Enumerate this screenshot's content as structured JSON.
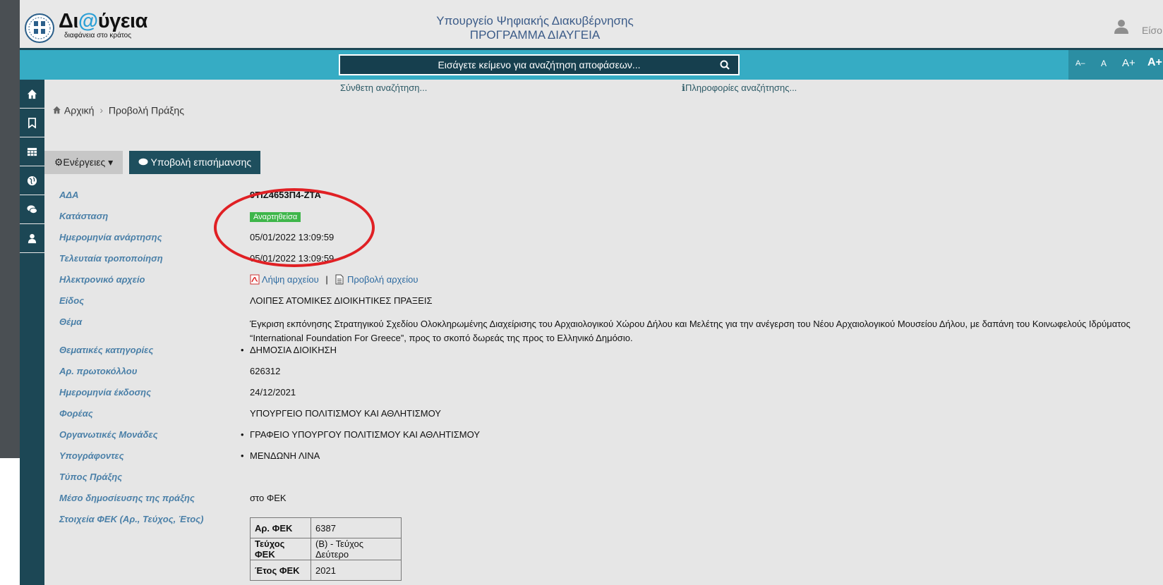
{
  "header": {
    "brand_title_pre": "Δι",
    "brand_title_at": "@",
    "brand_title_post": "ύγεια",
    "brand_subtitle": "διαφάνεια στο κράτος",
    "ministry_line1": "Υπουργείο Ψηφιακής Διακυβέρνησης",
    "ministry_line2": "ΠΡΟΓΡΑΜΜΑ ΔΙΑΥΓΕΙΑ",
    "login_label": "Είσο"
  },
  "search": {
    "placeholder": "Εισάγετε κείμενο για αναζήτηση αποφάσεων...",
    "advanced_link": "Σύνθετη αναζήτηση...",
    "info_link": "Πληροφορίες αναζήτησης...",
    "font_sizes": [
      "A–",
      "A",
      "A+",
      "A+"
    ]
  },
  "sidebar": {
    "icons": [
      "home-icon",
      "bookmark-icon",
      "table-icon",
      "globe-icon",
      "comments-icon",
      "user-icon"
    ]
  },
  "breadcrumb": {
    "home": "Αρχική",
    "current": "Προβολή Πράξης"
  },
  "actions": {
    "actions_label": "Ενέργειες",
    "submit_label": "Υποβολή επισήμανσης"
  },
  "fields": {
    "ada_label": "ΑΔΑ",
    "ada_value": "9ΤΙΖ4653Π4-ΖΤΑ",
    "status_label": "Κατάσταση",
    "status_value": "Αναρτηθείσα",
    "published_label": "Ημερομηνία ανάρτησης",
    "published_value": "05/01/2022 13:09:59",
    "modified_label": "Τελευταία τροποποίηση",
    "modified_value": "05/01/2022 13:09:59",
    "file_label": "Ηλεκτρονικό αρχείο",
    "file_download": "Λήψη αρχείου",
    "file_separator": "|",
    "file_view": "Προβολή αρχείου",
    "type_label": "Είδος",
    "type_value": "ΛΟΙΠΕΣ ΑΤΟΜΙΚΕΣ ΔΙΟΙΚΗΤΙΚΕΣ ΠΡΑΞΕΙΣ",
    "subject_label": "Θέμα",
    "subject_value": "Έγκριση εκπόνησης Στρατηγικού Σχεδίου Ολοκληρωμένης Διαχείρισης του Αρχαιολογικού Χώρου Δήλου και Μελέτης για την ανέγερση του Νέου Αρχαιολογικού Μουσείου Δήλου, με δαπάνη του Κοινωφελούς Ιδρύματος “International Foundation For Greece”, προς το σκοπό δωρεάς της προς το Ελληνικό Δημόσιο.",
    "categories_label": "Θεματικές κατηγορίες",
    "categories_value": "ΔΗΜΟΣΙΑ ΔΙΟΙΚΗΣΗ",
    "protocol_label": "Αρ. πρωτοκόλλου",
    "protocol_value": "626312",
    "issue_date_label": "Ημερομηνία έκδοσης",
    "issue_date_value": "24/12/2021",
    "org_label": "Φορέας",
    "org_value": "ΥΠΟΥΡΓΕΙΟ ΠΟΛΙΤΙΣΜΟΥ ΚΑΙ ΑΘΛΗΤΙΣΜΟΥ",
    "units_label": "Οργανωτικές Μονάδες",
    "units_value": "ΓΡΑΦΕΙΟ ΥΠΟΥΡΓΟΥ ΠΟΛΙΤΙΣΜΟΥ ΚΑΙ ΑΘΛΗΤΙΣΜΟΥ",
    "signers_label": "Υπογράφοντες",
    "signers_value": "ΜΕΝΔΩΝΗ ΛΙΝΑ",
    "act_type_label": "Τύπος Πράξης",
    "medium_label": "Μέσο δημοσίευσης της πράξης",
    "medium_value": "στο ΦΕΚ",
    "fek_label": "Στοιχεία ΦΕΚ (Αρ., Τεύχος, Έτος)"
  },
  "fek_table": [
    {
      "key": "Αρ. ΦΕΚ",
      "value": "6387"
    },
    {
      "key": "Τεύχος ΦΕΚ",
      "value": "(Β) - Τεύχος Δεύτερο"
    },
    {
      "key": "Έτος ΦΕΚ",
      "value": "2021"
    }
  ],
  "annotation_color": "#e02024",
  "status_color": "#3eb64a"
}
